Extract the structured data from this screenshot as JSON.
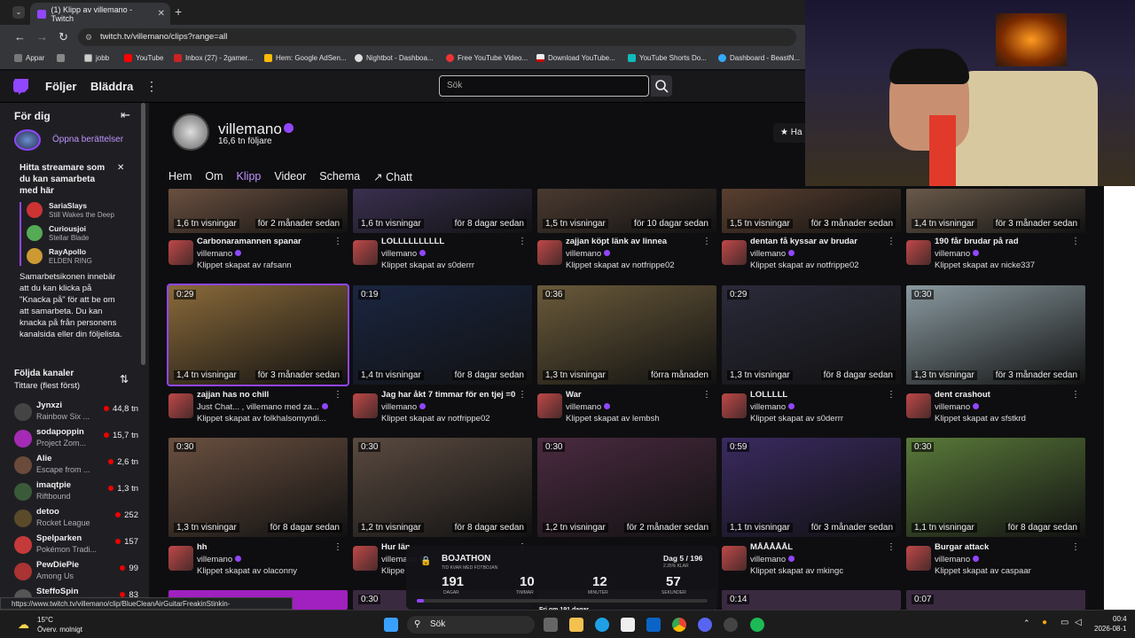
{
  "browser": {
    "tab_title": "(1) Klipp av villemano - Twitch",
    "tab_close": "✕",
    "new_tab": "+",
    "url": "twitch.tv/villemano/clips?range=all",
    "bookmarks": [
      "Appar",
      "jobb",
      "YouTube",
      "Inbox (27) - 2gamer...",
      "Hem: Google AdSen...",
      "Nightbot - Dashboa...",
      "Free YouTube Video...",
      "Download YouTube...",
      "YouTube Shorts Do...",
      "Dashboard - BeastN..."
    ]
  },
  "topnav": {
    "following": "Följer",
    "browse": "Bläddra",
    "search_placeholder": "Sök"
  },
  "sidebar": {
    "for_you": "För dig",
    "open_stories": "Öppna berättelser",
    "collab_title": "Hitta streamare som du kan samarbeta med här",
    "collab_close": "✕",
    "suggestions": [
      {
        "name": "SariaSlays",
        "game": "Still Wakes the Deep"
      },
      {
        "name": "Curiousjoi",
        "game": "Stellar Blade"
      },
      {
        "name": "RayApollo",
        "game": "ELDEN RING"
      }
    ],
    "collab_text": "Samarbetsikonen innebär att du kan klicka på \"Knacka på\" för att be om att samarbeta. Du kan knacka på från personens kanalsida eller din följelista.",
    "followed_title": "Följda kanaler",
    "followed_sub": "Tittare (flest först)",
    "channels": [
      {
        "name": "Jynxzi",
        "game": "Rainbow Six ...",
        "viewers": "44,8 tn",
        "color": "#444"
      },
      {
        "name": "sodapoppin",
        "game": "Project Zom...",
        "viewers": "15,7 tn",
        "color": "#a52ab5"
      },
      {
        "name": "Alie",
        "game": "Escape from ...",
        "viewers": "2,6 tn",
        "color": "#6a4a3a"
      },
      {
        "name": "imaqtpie",
        "game": "Riftbound",
        "viewers": "1,3 tn",
        "color": "#3a5a3a"
      },
      {
        "name": "detoo",
        "game": "Rocket League",
        "viewers": "252",
        "color": "#5a4a2a"
      },
      {
        "name": "Spelparken",
        "game": "Pokémon Tradi...",
        "viewers": "157",
        "color": "#c43a3a"
      },
      {
        "name": "PewDiePie",
        "game": "Among Us",
        "viewers": "99",
        "color": "#a33"
      },
      {
        "name": "SteffoSpin",
        "game": "",
        "viewers": "83",
        "color": "#555"
      }
    ]
  },
  "channel": {
    "name": "villemano",
    "followers": "16,6 tn följare",
    "follow_btn": "Ha",
    "tabs": [
      "Hem",
      "Om",
      "Klipp",
      "Videor",
      "Schema",
      "Chatt"
    ]
  },
  "clips_row1": [
    {
      "views": "1,6 tn visningar",
      "ago": "för 2 månader sedan",
      "title": "Carbonaramannen spanar",
      "channel": "villemano",
      "by": "Klippet skapat av rafsann"
    },
    {
      "views": "1,6 tn visningar",
      "ago": "för 8 dagar sedan",
      "title": "LOLLLLLLLLLL",
      "channel": "villemano",
      "by": "Klippet skapat av s0derrr"
    },
    {
      "views": "1,5 tn visningar",
      "ago": "för 10 dagar sedan",
      "title": "zajjan köpt länk av linnea",
      "channel": "villemano",
      "by": "Klippet skapat av notfrippe02"
    },
    {
      "views": "1,5 tn visningar",
      "ago": "för 3 månader sedan",
      "title": "dentan få kyssar av brudar",
      "channel": "villemano",
      "by": "Klippet skapat av notfrippe02"
    },
    {
      "views": "1,4 tn visningar",
      "ago": "för 3 månader sedan",
      "title": "190 får brudar på rad",
      "channel": "villemano",
      "by": "Klippet skapat av nicke337"
    }
  ],
  "clips_row2": [
    {
      "dur": "0:29",
      "views": "1,4 tn visningar",
      "ago": "för 3 månader sedan",
      "title": "zajjan has no chill",
      "channel": "Just Chat... , villemano med za...",
      "by": "Klippet skapat av folkhalsomyndi..."
    },
    {
      "dur": "0:19",
      "views": "1,4 tn visningar",
      "ago": "för 8 dagar sedan",
      "title": "Jag har åkt 7 timmar för en tjej =0",
      "channel": "villemano",
      "by": "Klippet skapat av notfrippe02"
    },
    {
      "dur": "0:36",
      "views": "1,3 tn visningar",
      "ago": "förra månaden",
      "title": "War",
      "channel": "villemano",
      "by": "Klippet skapat av lembsh"
    },
    {
      "dur": "0:29",
      "views": "1,3 tn visningar",
      "ago": "för 8 dagar sedan",
      "title": "LOLLLLL",
      "channel": "villemano",
      "by": "Klippet skapat av s0derrr"
    },
    {
      "dur": "0:30",
      "views": "1,3 tn visningar",
      "ago": "för 3 månader sedan",
      "title": "dent crashout",
      "channel": "villemano",
      "by": "Klippet skapat av sfstkrd"
    }
  ],
  "clips_row3": [
    {
      "dur": "0:30",
      "views": "1,3 tn visningar",
      "ago": "för 8 dagar sedan",
      "title": "hh",
      "channel": "villemano",
      "by": "Klippet skapat av olaconny"
    },
    {
      "dur": "0:30",
      "views": "1,2 tn visningar",
      "ago": "för 8 dagar sedan",
      "title": "Hur län",
      "channel": "villemano",
      "by": "Klippe"
    },
    {
      "dur": "0:30",
      "views": "1,2 tn visningar",
      "ago": "för 2 månader sedan",
      "title": "",
      "channel": "",
      "by": ""
    },
    {
      "dur": "0:59",
      "views": "1,1 tn visningar",
      "ago": "för 3 månader sedan",
      "title": "MÅÅÅÅÅL",
      "channel": "villemano",
      "by": "Klippet skapat av mkingc"
    },
    {
      "dur": "0:30",
      "views": "1,1 tn visningar",
      "ago": "för 8 dagar sedan",
      "title": "Burgar attack",
      "channel": "villemano",
      "by": "Klippet skapat av caspaar"
    }
  ],
  "clips_row4_durs": [
    "",
    "0:30",
    "",
    "0:14",
    "0:07"
  ],
  "widget": {
    "title": "BOJATHON",
    "subtitle": "TID KVAR MED FOTBOJAN",
    "day": "Dag 5 / 196",
    "pct": "2.35% KLAR",
    "days": "191",
    "days_l": "DAGAR",
    "hours": "10",
    "hours_l": "TIMMAR",
    "minutes": "12",
    "minutes_l": "MINUTER",
    "seconds": "57",
    "seconds_l": "SEKUNDER",
    "progress": 0.0235,
    "footer": "Fri om 191 dagar"
  },
  "status_url": "https://www.twitch.tv/villemano/clip/BlueCleanAirGuitarFreakinStinkin-ETvfaIpKZ6GlQ19u",
  "taskbar": {
    "weather_temp": "15°C",
    "weather_desc": "Överv. molnigt",
    "search": "Sök",
    "time": "00:4",
    "date": "2026-08-1"
  },
  "colors": {
    "accent": "#9146ff",
    "live": "#eb0400"
  }
}
